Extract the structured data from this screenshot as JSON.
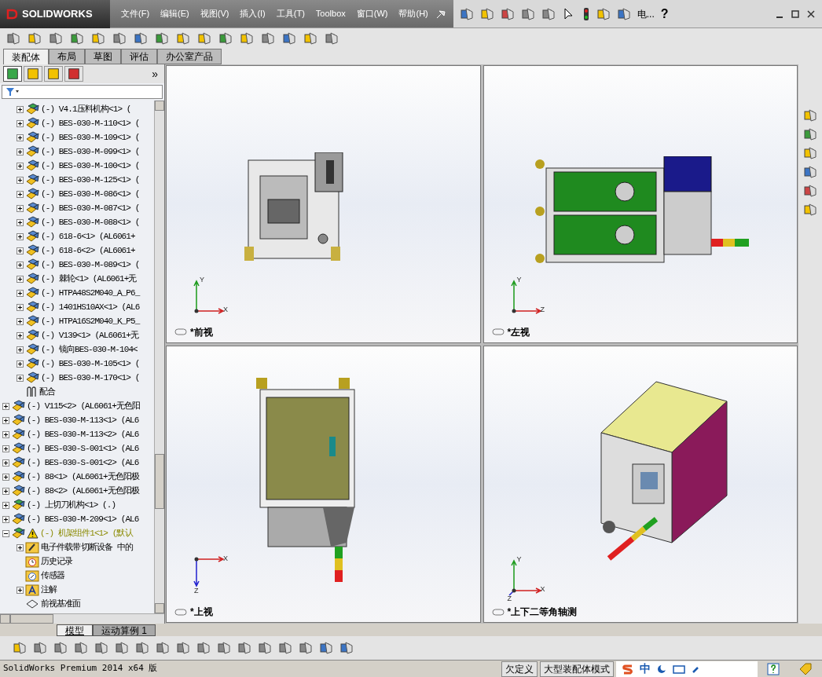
{
  "app": {
    "logo": "SOLIDWORKS",
    "menu": [
      "文件(F)",
      "编辑(E)",
      "视图(V)",
      "插入(I)",
      "工具(T)",
      "Toolbox",
      "窗口(W)",
      "帮助(H)"
    ],
    "toolbar_text": "电...",
    "help": "?"
  },
  "command_tabs": [
    {
      "label": "装配体",
      "selected": true
    },
    {
      "label": "布局",
      "selected": false
    },
    {
      "label": "草图",
      "selected": false
    },
    {
      "label": "评估",
      "selected": false
    },
    {
      "label": "办公室产品",
      "selected": false
    }
  ],
  "panel": {
    "more": "»"
  },
  "tree": [
    {
      "children": [
        {
          "label": "(-) V4.1压料机构<1> (",
          "kind": "subassembly",
          "expanded": false
        },
        {
          "label": "(-) BES-030-M-110<1> (",
          "kind": "part",
          "expanded": false
        },
        {
          "label": "(-) BES-030-M-109<1> (",
          "kind": "part",
          "expanded": false
        },
        {
          "label": "(-) BES-030-M-099<1> (",
          "kind": "part",
          "expanded": false
        },
        {
          "label": "(-) BES-030-M-100<1> (",
          "kind": "part",
          "expanded": false
        },
        {
          "label": "(-) BES-030-M-125<1> (",
          "kind": "part",
          "expanded": false
        },
        {
          "label": "(-) BES-030-M-086<1> (",
          "kind": "part",
          "expanded": false
        },
        {
          "label": "(-) BES-030-M-087<1> (",
          "kind": "part",
          "expanded": false
        },
        {
          "label": "(-) BES-030-M-088<1> (",
          "kind": "part",
          "expanded": false
        },
        {
          "label": "(-) 618-6<1> (AL6061+",
          "kind": "part",
          "expanded": false
        },
        {
          "label": "(-) 618-6<2> (AL6061+",
          "kind": "part",
          "expanded": false
        },
        {
          "label": "(-) BES-030-M-089<1> (",
          "kind": "part",
          "expanded": false
        },
        {
          "label": "(-) 棘轮<1> (AL6061+无",
          "kind": "part",
          "expanded": false
        },
        {
          "label": "(-) HTPA48S2M040_A_P6_",
          "kind": "part",
          "expanded": false
        },
        {
          "label": "(-) 1401HS10AX<1> (AL6",
          "kind": "part",
          "expanded": false
        },
        {
          "label": "(-) HTPA16S2M040_K_P5_",
          "kind": "part",
          "expanded": false
        },
        {
          "label": "(-) V139<1> (AL6061+无",
          "kind": "part",
          "expanded": false
        },
        {
          "label": "(-) 镜向BES-030-M-104<",
          "kind": "part",
          "expanded": false
        },
        {
          "label": "(-) BES-030-M-105<1> (",
          "kind": "part",
          "expanded": false
        },
        {
          "label": "(-) BES-030-M-170<1> (",
          "kind": "part",
          "expanded": false
        },
        {
          "label": "配合",
          "kind": "mates"
        }
      ]
    },
    {
      "label": "(-) V115<2> (AL6061+无色阳",
      "kind": "part",
      "expanded": false
    },
    {
      "label": "(-) BES-030-M-113<1> (AL6",
      "kind": "part",
      "expanded": false
    },
    {
      "label": "(-) BES-030-M-113<2> (AL6",
      "kind": "part",
      "expanded": false
    },
    {
      "label": "(-) BES-030-S-001<1> (AL6",
      "kind": "part",
      "expanded": false
    },
    {
      "label": "(-) BES-030-S-001<2> (AL6",
      "kind": "part",
      "expanded": false
    },
    {
      "label": "(-) 88<1> (AL6061+无色阳极",
      "kind": "part",
      "expanded": false
    },
    {
      "label": "(-) 88<2> (AL6061+无色阳极",
      "kind": "part",
      "expanded": false
    },
    {
      "label": "(-) 上切刀机构<1> (.)",
      "kind": "subassembly",
      "expanded": false
    },
    {
      "label": "(-) BES-030-M-209<1> (AL6",
      "kind": "part",
      "expanded": false
    },
    {
      "label": "(-) 机架组件1<1> (默认",
      "kind": "subassembly",
      "expanded": true,
      "warning": true,
      "children": [
        {
          "label": "电子件载带切断设备 中的",
          "kind": "document",
          "expanded": false
        },
        {
          "label": "历史记录",
          "kind": "history"
        },
        {
          "label": "传感器",
          "kind": "sensor"
        },
        {
          "label": "注解",
          "kind": "annotation",
          "expanded": false
        },
        {
          "label": "前视基准面",
          "kind": "plane"
        }
      ]
    }
  ],
  "viewports": [
    {
      "kind": "front",
      "label": "*前视",
      "axes": [
        {
          "kind": "up",
          "label": "Y"
        },
        {
          "kind": "right",
          "label": "X"
        }
      ]
    },
    {
      "kind": "left",
      "label": "*左视",
      "axes": [
        {
          "kind": "up",
          "label": "Y"
        },
        {
          "kind": "right",
          "label": "Z"
        }
      ]
    },
    {
      "kind": "top",
      "label": "*上视",
      "axes": [
        {
          "kind": "right",
          "label": "X"
        },
        {
          "kind": "down",
          "label": "Z"
        }
      ]
    },
    {
      "kind": "iso",
      "label": "*上下二等角轴测",
      "axes": [
        {
          "kind": "up",
          "label": "Y"
        },
        {
          "kind": "right",
          "label": "X"
        },
        {
          "kind": "down-left",
          "label": "Z"
        }
      ]
    }
  ],
  "bottom_tabs": [
    {
      "label": "模型",
      "selected": true
    },
    {
      "label": "运动算例 1",
      "selected": false
    }
  ],
  "status": {
    "product": "SolidWorks Premium 2014 x64 版",
    "fields": [
      "欠定义",
      "大型装配体模式"
    ],
    "ime": "中"
  }
}
